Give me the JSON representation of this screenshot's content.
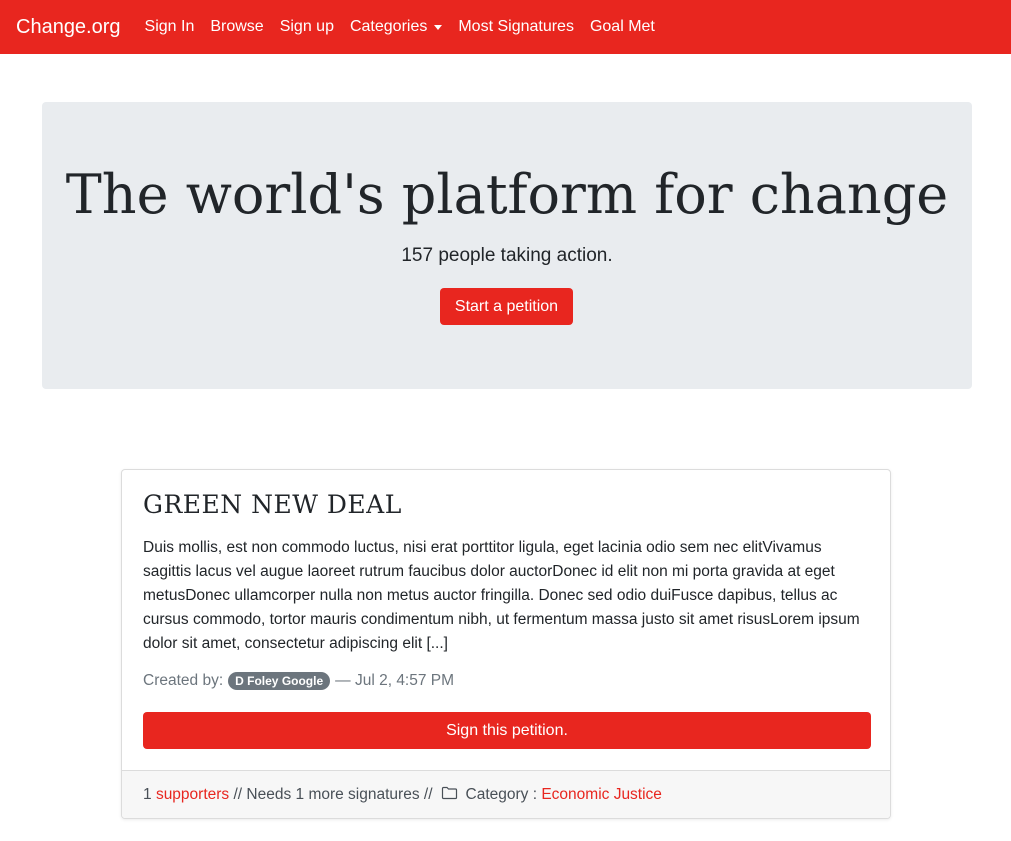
{
  "navbar": {
    "brand": "Change.org",
    "links": [
      "Sign In",
      "Browse",
      "Sign up",
      "Categories",
      "Most Signatures",
      "Goal Met"
    ],
    "accent_color": "#e8261f"
  },
  "hero": {
    "title": "The world's platform for change",
    "subtitle": "157 people taking action.",
    "cta_label": "Start a petition"
  },
  "petition": {
    "title": "GREEN NEW DEAL",
    "description": "Duis mollis, est non commodo luctus, nisi erat porttitor ligula, eget lacinia odio sem nec elitVivamus sagittis lacus vel augue laoreet rutrum faucibus dolor auctorDonec id elit non mi porta gravida at eget metusDonec ullamcorper nulla non metus auctor fringilla. Donec sed odio duiFusce dapibus, tellus ac cursus commodo, tortor mauris condimentum nibh, ut fermentum massa justo sit amet risusLorem ipsum dolor sit amet, consectetur adipiscing elit [...]",
    "created_by_label": "Created by:",
    "author": "D Foley Google",
    "date_sep": "— Jul 2, 4:57 PM",
    "sign_label": "Sign this petition.",
    "footer": {
      "supporters_count": "1",
      "supporters_label": "supporters",
      "needs_text": "// Needs 1 more signatures //",
      "category_label": "Category :",
      "category_value": "Economic Justice",
      "folder_icon": "folder-icon"
    }
  }
}
